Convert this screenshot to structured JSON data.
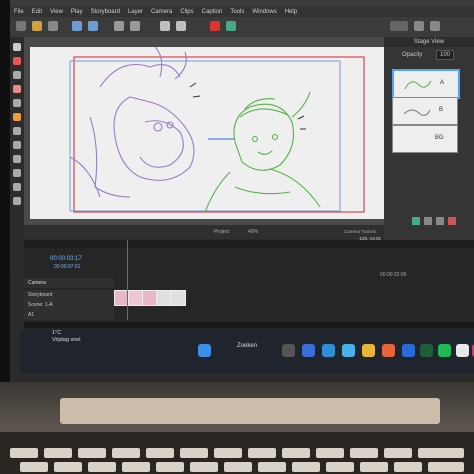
{
  "app": {
    "menu": [
      "File",
      "Edit",
      "View",
      "Play",
      "Storyboard",
      "Layer",
      "Camera",
      "Clips",
      "Caption",
      "Tools",
      "Windows",
      "Help"
    ]
  },
  "stage_view": {
    "title": "Stage View",
    "opacity_label": "Opacity",
    "opacity_value": "100",
    "layers": [
      {
        "label": "A",
        "selected": true
      },
      {
        "label": "B",
        "selected": false
      },
      {
        "label": "BG",
        "selected": false
      }
    ]
  },
  "canvas_status": {
    "view_label": "Project",
    "zoom": "40%",
    "camera_label": "Camera Transfo",
    "coords": "-125,-14,01"
  },
  "timeline": {
    "current_time": "00:00:03:17",
    "sub_time": "00:00:07:01",
    "ruler_mark": "00:00:32:00",
    "tracks": [
      "Camera",
      "Storyboard",
      "Scene: 1-A",
      "A1"
    ]
  },
  "taskbar": {
    "weather_temp": "1°C",
    "weather_desc": "Vrijdag snel",
    "search_label": "Zoeken"
  },
  "colors": {
    "selection": "#4fa3ff",
    "playhead": "#e23a3a",
    "sketch_purple": "#9a7cc8",
    "sketch_green": "#56b24a",
    "camera_frame": "#d8484a"
  }
}
